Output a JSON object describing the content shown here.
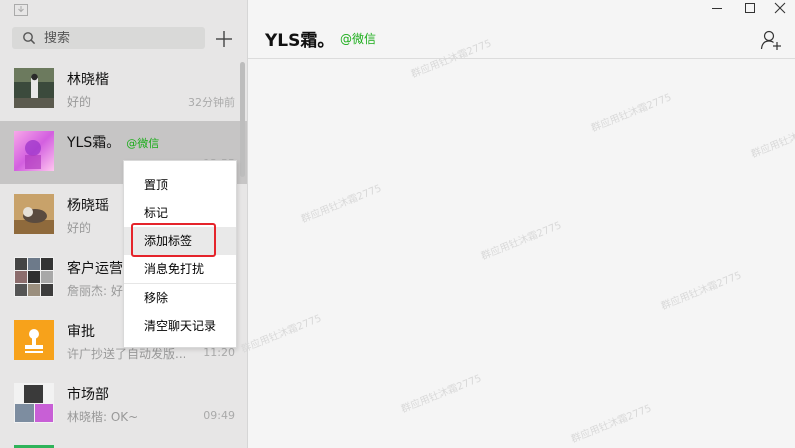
{
  "sidebar": {
    "search_placeholder": "搜索",
    "items": [
      {
        "name": "林晓楷",
        "tag": "",
        "message": "好的",
        "time": "32分钟前"
      },
      {
        "name": "YLS霜。",
        "tag": "@微信",
        "message": "",
        "time": "12:55"
      },
      {
        "name": "杨晓瑶",
        "tag": "",
        "message": "好的",
        "time": ""
      },
      {
        "name": "客户运营协",
        "tag": "",
        "message": "詹丽杰: 好",
        "time": ""
      },
      {
        "name": "审批",
        "tag": "",
        "message": "许广抄送了自动发版...",
        "time": "11:20"
      },
      {
        "name": "市场部",
        "tag": "",
        "message": "林晓楷: OK~",
        "time": "09:49"
      }
    ]
  },
  "header": {
    "title": "YLS霜。",
    "tag": "@微信"
  },
  "context_menu": {
    "items": [
      "置顶",
      "标记",
      "添加标签",
      "消息免打扰",
      "移除",
      "清空聊天记录"
    ]
  },
  "watermark": "群应用钍沐霜2775",
  "colors": {
    "accent_green": "#1aad19",
    "highlight_red": "#e5242b",
    "approval_orange": "#f7a21b"
  }
}
